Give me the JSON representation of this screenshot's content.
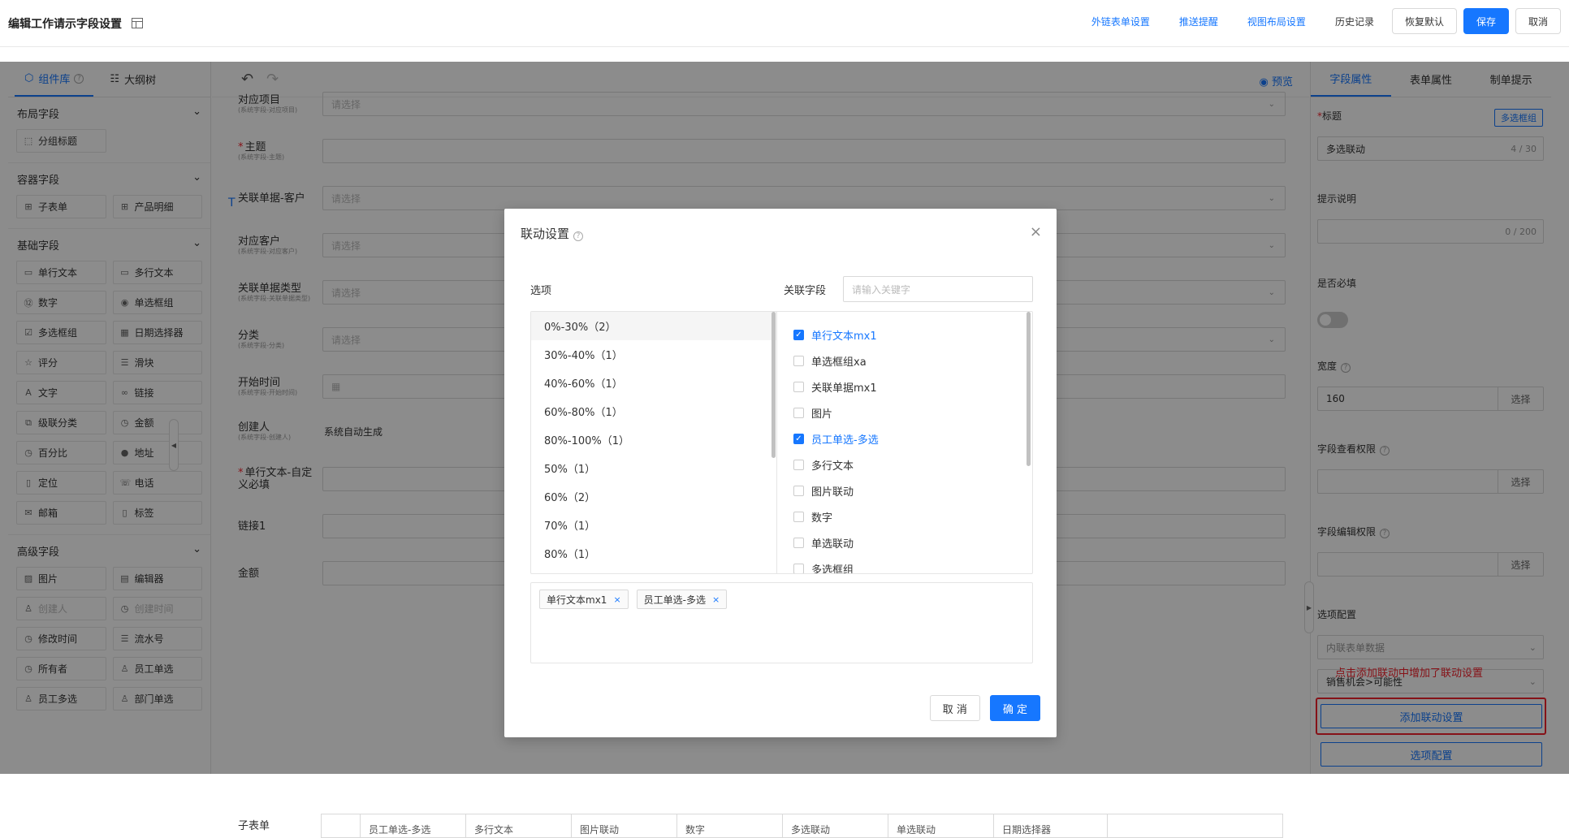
{
  "header": {
    "title": "编辑工作请示字段设置",
    "links": [
      "外链表单设置",
      "推送提醒",
      "视图布局设置"
    ],
    "history": "历史记录",
    "restore": "恢复默认",
    "save": "保存",
    "cancel": "取消"
  },
  "left": {
    "tab_components": "组件库",
    "tab_outline": "大纲树",
    "sections": [
      {
        "title": "布局字段",
        "items": [
          {
            "icon": "⬚",
            "label": "分组标题"
          }
        ]
      },
      {
        "title": "容器字段",
        "items": [
          {
            "icon": "⊞",
            "label": "子表单"
          },
          {
            "icon": "⊞",
            "label": "产品明细"
          }
        ]
      },
      {
        "title": "基础字段",
        "items": [
          {
            "icon": "▭",
            "label": "单行文本"
          },
          {
            "icon": "▭",
            "label": "多行文本"
          },
          {
            "icon": "⑫",
            "label": "数字"
          },
          {
            "icon": "◉",
            "label": "单选框组"
          },
          {
            "icon": "☑",
            "label": "多选框组"
          },
          {
            "icon": "▦",
            "label": "日期选择器"
          },
          {
            "icon": "☆",
            "label": "评分"
          },
          {
            "icon": "☰",
            "label": "滑块"
          },
          {
            "icon": "A",
            "label": "文字"
          },
          {
            "icon": "∞",
            "label": "链接"
          },
          {
            "icon": "⧉",
            "label": "级联分类"
          },
          {
            "icon": "◷",
            "label": "金额"
          },
          {
            "icon": "◷",
            "label": "百分比"
          },
          {
            "icon": "●",
            "label": "地址"
          },
          {
            "icon": "▯",
            "label": "定位"
          },
          {
            "icon": "☏",
            "label": "电话"
          },
          {
            "icon": "✉",
            "label": "邮箱"
          },
          {
            "icon": "▯",
            "label": "标签"
          }
        ]
      },
      {
        "title": "高级字段",
        "items": [
          {
            "icon": "▨",
            "label": "图片"
          },
          {
            "icon": "▤",
            "label": "编辑器"
          },
          {
            "icon": "♙",
            "label": "创建人",
            "disabled": true
          },
          {
            "icon": "◷",
            "label": "创建时间",
            "disabled": true
          },
          {
            "icon": "◷",
            "label": "修改时间"
          },
          {
            "icon": "☰",
            "label": "流水号"
          },
          {
            "icon": "◷",
            "label": "所有者"
          },
          {
            "icon": "♙",
            "label": "员工单选"
          },
          {
            "icon": "♙",
            "label": "员工多选"
          },
          {
            "icon": "♙",
            "label": "部门单选"
          }
        ]
      }
    ]
  },
  "canvas": {
    "preview": "预览",
    "fields": [
      {
        "label": "对应项目",
        "sub": "(系统字段-对应项目)",
        "placeholder": "请选择",
        "type": "select"
      },
      {
        "label": "主题",
        "sub": "(系统字段-主题)",
        "placeholder": "",
        "type": "input",
        "required": true
      },
      {
        "label": "关联单据-客户",
        "sub": "",
        "placeholder": "请选择",
        "type": "select"
      },
      {
        "label": "对应客户",
        "sub": "(系统字段-对应客户)",
        "placeholder": "请选择",
        "type": "select"
      },
      {
        "label": "关联单据类型",
        "sub": "(系统字段-关联单据类型)",
        "placeholder": "请选择",
        "type": "select"
      },
      {
        "label": "分类",
        "sub": "(系统字段-分类)",
        "placeholder": "请选择",
        "type": "select"
      },
      {
        "label": "开始时间",
        "sub": "(系统字段-开始时间)",
        "placeholder": "",
        "type": "date"
      },
      {
        "label": "创建人",
        "sub": "(系统字段-创建人)",
        "placeholder": "系统自动生成",
        "type": "text"
      },
      {
        "label": "单行文本-自定义必填",
        "sub": "",
        "placeholder": "",
        "type": "input",
        "required": true
      },
      {
        "label": "链接1",
        "sub": "",
        "placeholder": "",
        "type": "input"
      },
      {
        "label": "金额",
        "sub": "",
        "placeholder": "",
        "type": "input"
      }
    ],
    "subtable_label": "子表单",
    "subtable_cols": [
      "",
      "员工单选-多选",
      "多行文本",
      "图片联动",
      "数字",
      "多选联动",
      "单选联动",
      "日期选择器"
    ]
  },
  "right": {
    "tabs": [
      "字段属性",
      "表单属性",
      "制单提示"
    ],
    "title_label": "标题",
    "type_tag": "多选框组",
    "title_value": "多选联动",
    "title_count": "4 / 30",
    "hint_label": "提示说明",
    "hint_count": "0 / 200",
    "required_label": "是否必填",
    "width_label": "宽度",
    "width_value": "160",
    "select_label": "选择",
    "view_perm_label": "字段查看权限",
    "edit_perm_label": "字段编辑权限",
    "options_label": "选项配置",
    "options_source": "内联表单数据",
    "options_field": "销售机会>可能性",
    "annotation": "点击添加联动中增加了联动设置",
    "add_linkage": "添加联动设置",
    "options_config": "选项配置"
  },
  "modal": {
    "title": "联动设置",
    "options_label": "选项",
    "fields_label": "关联字段",
    "search_placeholder": "请输入关键字",
    "options": [
      "0%-30%（2）",
      "30%-40%（1）",
      "40%-60%（1）",
      "60%-80%（1）",
      "80%-100%（1）",
      "50%（1）",
      "60%（2）",
      "70%（1）",
      "80%（1）"
    ],
    "fields": [
      {
        "label": "单行文本mx1",
        "checked": true
      },
      {
        "label": "单选框组xa",
        "checked": false
      },
      {
        "label": "关联单据mx1",
        "checked": false
      },
      {
        "label": "图片",
        "checked": false
      },
      {
        "label": "员工单选-多选",
        "checked": true
      },
      {
        "label": "多行文本",
        "checked": false
      },
      {
        "label": "图片联动",
        "checked": false
      },
      {
        "label": "数字",
        "checked": false
      },
      {
        "label": "单选联动",
        "checked": false
      },
      {
        "label": "多选框组",
        "checked": false
      }
    ],
    "tags": [
      "单行文本mx1",
      "员工单选-多选"
    ],
    "cancel": "取 消",
    "confirm": "确 定"
  }
}
